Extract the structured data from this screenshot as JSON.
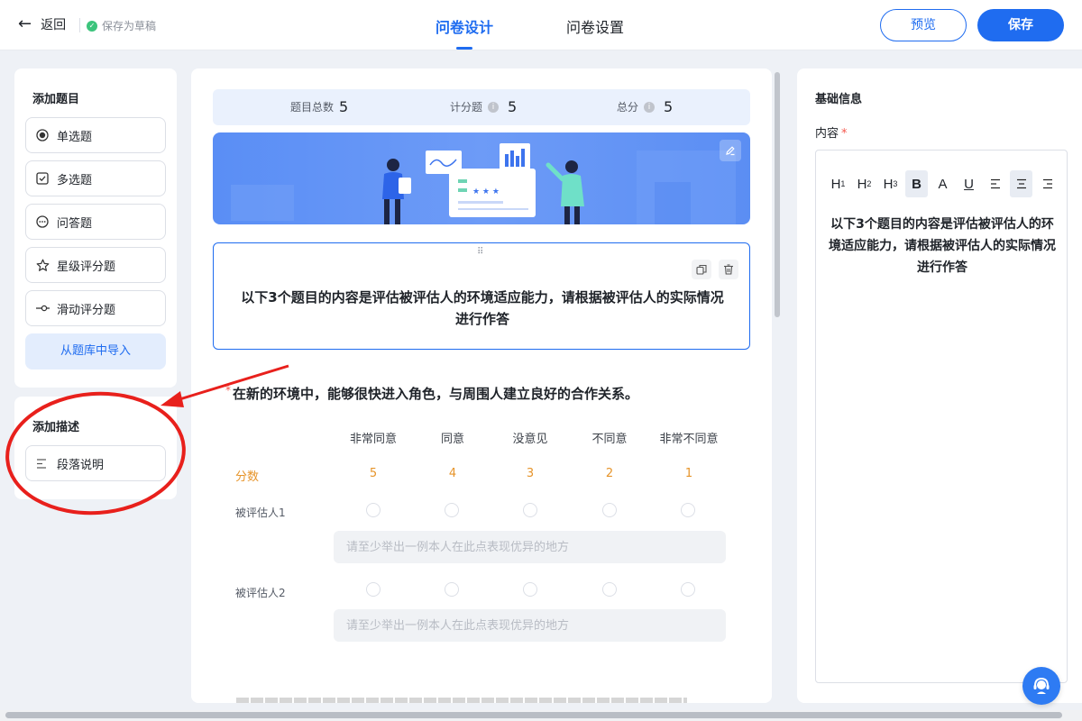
{
  "header": {
    "back_label": "返回",
    "draft_label": "保存为草稿",
    "tabs": [
      {
        "label": "问卷设计",
        "active": true
      },
      {
        "label": "问卷设置",
        "active": false
      }
    ],
    "preview_label": "预览",
    "save_label": "保存"
  },
  "left": {
    "add_question_title": "添加题目",
    "question_types": [
      {
        "label": "单选题",
        "icon": "radio-icon"
      },
      {
        "label": "多选题",
        "icon": "checkbox-icon"
      },
      {
        "label": "问答题",
        "icon": "chat-icon"
      },
      {
        "label": "星级评分题",
        "icon": "star-icon"
      },
      {
        "label": "滑动评分题",
        "icon": "slider-icon"
      }
    ],
    "import_label": "从题库中导入",
    "add_desc_title": "添加描述",
    "paragraph_label": "段落说明"
  },
  "stats": {
    "total_label": "题目总数",
    "total_value": "5",
    "scored_label": "计分题",
    "scored_value": "5",
    "points_label": "总分",
    "points_value": "5"
  },
  "description": {
    "text": "以下3个题目的内容是评估被评估人的环境适应能力，请根据被评估人的实际情况进行作答"
  },
  "question": {
    "title": "在新的环境中，能够很快进入角色，与周围人建立良好的合作关系。",
    "columns": [
      "非常同意",
      "同意",
      "没意见",
      "不同意",
      "非常不同意"
    ],
    "score_label": "分数",
    "scores": [
      "5",
      "4",
      "3",
      "2",
      "1"
    ],
    "rows": [
      {
        "label": "被评估人1",
        "placeholder": "请至少举出一例本人在此点表现优异的地方"
      },
      {
        "label": "被评估人2",
        "placeholder": "请至少举出一例本人在此点表现优异的地方"
      }
    ]
  },
  "right": {
    "title": "基础信息",
    "content_label": "内容",
    "toolbar": [
      "H1",
      "H2",
      "H3",
      "B",
      "A",
      "U",
      "align-left",
      "align-center",
      "align-right"
    ],
    "editor_text": "以下3个题目的内容是评估被评估人的环境适应能力，请根据被评估人的实际情况进行作答"
  },
  "colors": {
    "primary": "#1f6cf0",
    "score": "#e6942a",
    "required": "#f5584d",
    "annotation": "#e8201c"
  }
}
